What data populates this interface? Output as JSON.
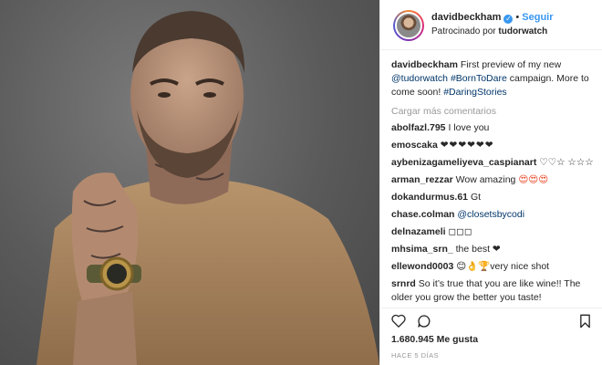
{
  "post": {
    "photo_alt": "Man in beige sweater with tattooed hand and gold watch",
    "header": {
      "username": "davidbeckham",
      "verified_icon": "verified-badge-icon",
      "separator": "•",
      "follow_label": "Seguir",
      "sponsored_prefix": "Patrocinado por",
      "sponsor": "tudorwatch"
    },
    "caption": {
      "username": "davidbeckham",
      "text_1": "First preview of my new",
      "mention": "@tudorwatch",
      "tag_1": "#BornToDare",
      "text_2": "campaign. More to come soon!",
      "tag_2": "#DaringStories"
    },
    "load_more": "Cargar más comentarios",
    "comments": [
      {
        "user": "abolfazl.795",
        "text": "I love you"
      },
      {
        "user": "emoscaka",
        "text": "❤❤❤❤❤❤"
      },
      {
        "user": "aybenizagameliyeva_caspianart",
        "text": "♡♡☆ ☆☆☆"
      },
      {
        "user": "arman_rezzar",
        "text": "Wow amazing",
        "emoji": "😍😍😍"
      },
      {
        "user": "dokandurmus.61",
        "text": "Gt"
      },
      {
        "user": "chase.colman",
        "text": "@closetsbycodi"
      },
      {
        "user": "delnazameli",
        "text": "◻◻◻"
      },
      {
        "user": "mhsima_srn_",
        "text": "the best ❤"
      },
      {
        "user": "ellewond0003",
        "text": "😊👌🏆very nice shot"
      },
      {
        "user": "srnrd",
        "text": "So it’s true that you are like wine!! The older you grow the better you taste!"
      }
    ],
    "actions": {
      "like_icon": "heart-icon",
      "comment_icon": "comment-icon",
      "save_icon": "bookmark-icon"
    },
    "likes": "1.680.945 Me gusta",
    "time_ago": "HACE 5 DÍAS"
  }
}
